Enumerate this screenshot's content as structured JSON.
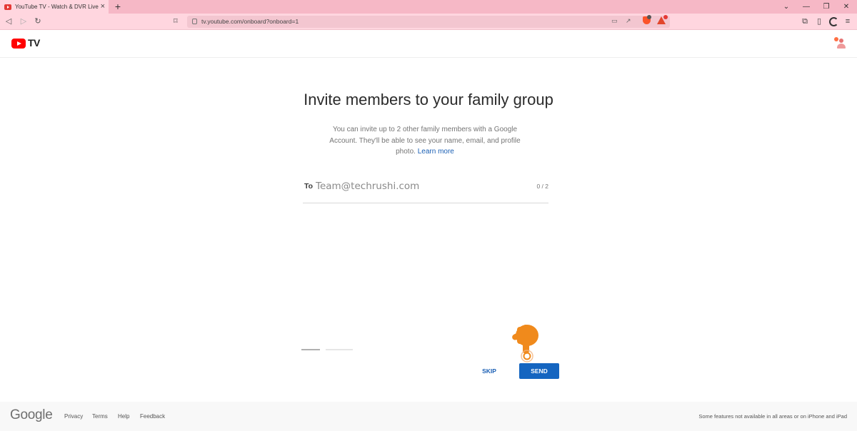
{
  "browser": {
    "tab_title": "YouTube TV - Watch & DVR Live",
    "tab_close": "×",
    "new_tab": "+",
    "url": "tv.youtube.com/onboard?onboard=1"
  },
  "header": {
    "logo_text": "TV"
  },
  "main": {
    "title": "Invite members to your family group",
    "description": "You can invite up to 2 other family members with a Google Account. They'll be able to see your name, email, and profile photo.",
    "learn_more": "Learn more",
    "to_label": "To",
    "to_value": "Team@techrushi.com",
    "counter": "0 / 2",
    "skip_label": "SKIP",
    "send_label": "SEND",
    "progress": {
      "current_step": 1,
      "total_steps": 2
    }
  },
  "footer": {
    "logo": "Google",
    "links": [
      "Privacy",
      "Terms",
      "Help",
      "Feedback"
    ],
    "note": "Some features not available in all areas or on iPhone and iPad"
  },
  "colors": {
    "accent": "#1565c0",
    "link": "#1a5fb4",
    "youtube_red": "#ff0000",
    "browser_frame": "#f6b8c6",
    "hand_overlay": "#f08a1c"
  }
}
